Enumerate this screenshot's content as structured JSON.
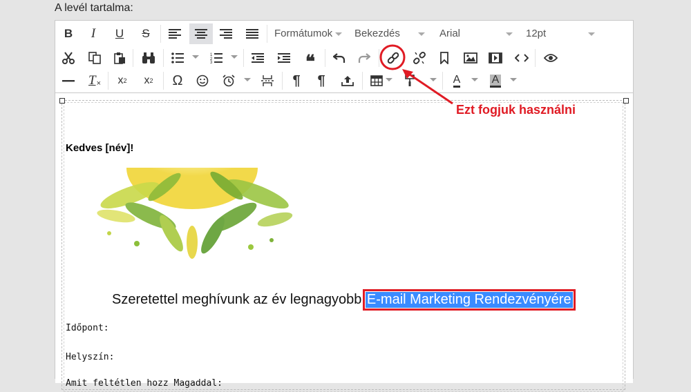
{
  "section_label": "A levél tartalma:",
  "toolbar": {
    "format_menu": "Formátumok",
    "block_menu": "Bekezdés",
    "font_menu": "Arial",
    "size_menu": "12pt",
    "bold": "B",
    "italic": "I",
    "underline": "U",
    "strike": "S",
    "quote": "❝",
    "omega": "Ω",
    "subscript_x": "x",
    "subscript_2": "2",
    "superscript_x": "x",
    "superscript_2": "2",
    "pilcrow": "¶",
    "text_color": "A",
    "bg_color": "A",
    "clear_format": "T"
  },
  "content": {
    "greeting": "Kedves [név]!",
    "invite_text": "Szeretettel meghívunk az év legnagyobb",
    "invite_highlight": "E-mail Marketing Rendezvényére",
    "fields": [
      "Időpont:",
      "Helyszín:",
      "Amit feltétlen hozz Magaddal:"
    ]
  },
  "annotation": "Ezt fogjuk használni",
  "colors": {
    "accent_red": "#e01b24",
    "highlight_blue": "#3a8bff",
    "toolbar_active": "#dfe0e3"
  }
}
